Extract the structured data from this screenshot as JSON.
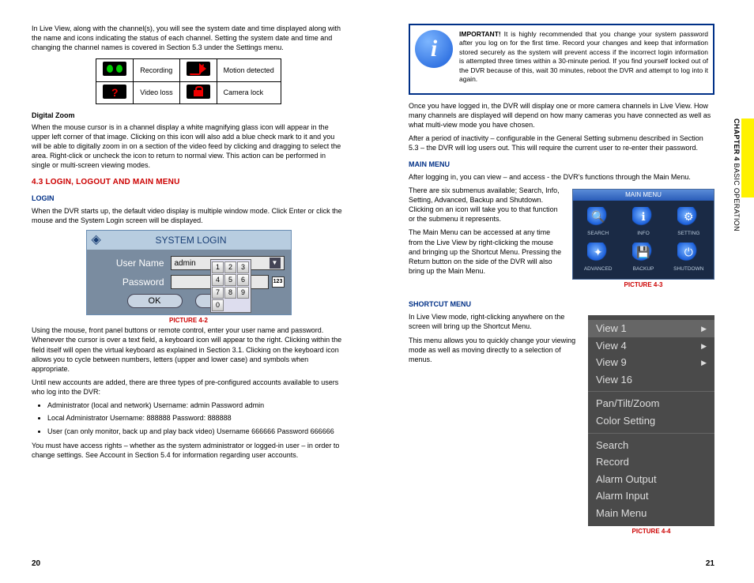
{
  "left": {
    "intro": "In Live View, along with the channel(s), you will see the system date and time displayed along with the name and icons indicating the status of each channel. Setting the system date and time and changing the channel names is covered in Section 5.3 under the Settings menu.",
    "status": {
      "rec": "Recording",
      "motion": "Motion detected",
      "loss": "Video loss",
      "lock": "Camera lock"
    },
    "digital_zoom_h": "Digital Zoom",
    "digital_zoom": "When the mouse cursor is in a channel display a white magnifying glass icon will appear in the upper left corner of that image. Clicking on this icon will also add a blue check mark to it and you will be able to digitally zoom in on a section of the video feed by clicking and dragging to select the area. Right-click or uncheck the icon to return to normal view. This action can be performed in single or multi-screen viewing modes.",
    "sec43": "4.3 LOGIN, LOGOUT AND MAIN MENU",
    "login_h": "LOGIN",
    "login_p1": "When the DVR starts up, the default video display is multiple window mode. Click Enter or click the mouse and the System Login screen will be displayed.",
    "syslogin": {
      "title": "SYSTEM LOGIN",
      "user_label": "User Name",
      "user_value": "admin",
      "pass_label": "Password",
      "kb": "123",
      "ok": "OK",
      "cancel": "ncel",
      "keys": [
        "1",
        "2",
        "3",
        "4",
        "5",
        "6",
        "7",
        "8",
        "9",
        "0"
      ]
    },
    "pic42": "PICTURE 4-2",
    "login_p2": "Using the mouse, front panel buttons or remote control, enter your user name and password. Whenever the cursor is over a text field, a keyboard icon will appear to the right. Clicking within the field itself will open the virtual keyboard as explained in Section 3.1. Clicking on the keyboard icon allows you to cycle between numbers, letters (upper and lower case) and symbols when appropriate.",
    "login_p3": "Until new accounts are added, there are three types of pre-configured accounts available to users who log into the DVR:",
    "accounts": [
      "Administrator (local and network) Username: admin Password admin",
      "Local Administrator Username: 888888 Password: 888888",
      "User (can only monitor, back up and play back video) Username 666666 Password 666666"
    ],
    "login_p4": "You must have access rights – whether as the system administrator or logged-in user – in order to change settings. See Account in Section 5.4 for information regarding user accounts.",
    "pagenum": "20"
  },
  "right": {
    "important_label": "IMPORTANT!",
    "important_text": " It is highly recommended that you change your system password after you log on for the first time. Record your changes and keep that information stored securely as the system will prevent access if the incorrect login information is attempted three times within a 30-minute period. If you find yourself locked out of the DVR because of this, wait 30 minutes, reboot the DVR and attempt to log into it again.",
    "p1": "Once you have logged in, the DVR will display one or more camera channels in Live View. How many channels are displayed will depend on how many cameras you have connected as well as what multi-view mode you have chosen.",
    "p2": "After a period of inactivity – configurable in the General Setting submenu described in Section 5.3 – the DVR will log users out. This will require the current user to re-enter their password.",
    "mainmenu_h": "MAIN MENU",
    "mainmenu_intro": "After logging in, you can view – and access - the DVR's functions through the Main Menu.",
    "mm_p1": "There are six submenus available; Search, Info, Setting, Advanced, Backup and Shutdown. Clicking on an icon will take you to that function or the submenu it represents.",
    "mm_p2": "The Main Menu can be accessed at any time from the Live View by right-clicking the mouse and bringing up the Shortcut Menu. Pressing the Return button on the side of the DVR will also bring up the Main Menu.",
    "mm_items": [
      "SEARCH",
      "INFO",
      "SETTING",
      "ADVANCED",
      "BACKUP",
      "SHUTDOWN"
    ],
    "mm_title": "MAIN MENU",
    "pic43": "PICTURE 4-3",
    "shortcut_h": "SHORTCUT MENU",
    "sc_p1": "In Live View mode, right-clicking anywhere on the screen will bring up the Shortcut Menu.",
    "sc_p2": "This menu allows you to quickly change your viewing mode as well as moving directly to a selection of menus.",
    "sc_items1": [
      "View 1",
      "View 4",
      "View 9",
      "View 16"
    ],
    "sc_items2": [
      "Pan/Tilt/Zoom",
      "Color Setting"
    ],
    "sc_items3": [
      "Search",
      "Record",
      "Alarm Output",
      "Alarm Input",
      "Main Menu"
    ],
    "pic44": "PICTURE 4-4",
    "pagenum": "21",
    "side_chapter": "CHAPTER 4",
    "side_title": " BASIC OPERATION"
  }
}
